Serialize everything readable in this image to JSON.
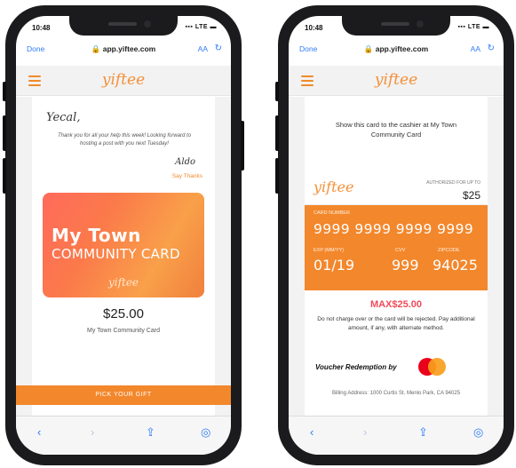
{
  "left": {
    "status": {
      "time": "10:48",
      "signal": "▪▪▪ LTE ▬"
    },
    "browser": {
      "done": "Done",
      "url": "🔒 app.yiftee.com",
      "text_size": "AA",
      "reload": "↻"
    },
    "header": {
      "logo": "yiftee"
    },
    "note": {
      "greeting": "Yecal,",
      "message": "Thank you for all your help this week! Looking forward to hosting a post with you next Tuesday!",
      "signature": "Aldo",
      "say_thanks": "Say Thanks"
    },
    "gift_card": {
      "line1": "My Town",
      "line2": "COMMUNITY CARD",
      "logo": "yiftee"
    },
    "amount": "$25.00",
    "card_name": "My Town Community Card",
    "pick_button": "PICK YOUR GIFT",
    "toolbar": {
      "back": "‹",
      "forward": "›",
      "share": "⇪",
      "compass": "◎"
    }
  },
  "right": {
    "status": {
      "time": "10:48",
      "signal": "▪▪▪ LTE ▬"
    },
    "browser": {
      "done": "Done",
      "url": "🔒 app.yiftee.com",
      "text_size": "AA",
      "reload": "↻"
    },
    "header": {
      "logo": "yiftee"
    },
    "instructions": "Show this card to the cashier at My Town Community Card",
    "card": {
      "logo": "yiftee",
      "authorized_label": "AUTHORIZED FOR UP TO",
      "authorized_value": "$25",
      "number_label": "CARD NUMBER",
      "number": "9999 9999 9999 9999",
      "exp_label": "EXP (MM/YY)",
      "exp": "01/19",
      "cvv_label": "CVV",
      "cvv": "999",
      "zip_label": "ZIPCODE",
      "zip": "94025"
    },
    "max": "MAX$25.00",
    "warning": "Do not charge over or the card will be rejected. Pay additional amount, if any, with alternate method.",
    "voucher": "Voucher Redemption by",
    "billing": "Billing Address: 1000 Curtis St. Menlo Park, CA 94025",
    "toolbar": {
      "back": "‹",
      "forward": "›",
      "share": "⇪",
      "compass": "◎"
    }
  },
  "colors": {
    "accent": "#f3872c",
    "link": "#2f7cf6",
    "max": "#ef4a5a"
  }
}
